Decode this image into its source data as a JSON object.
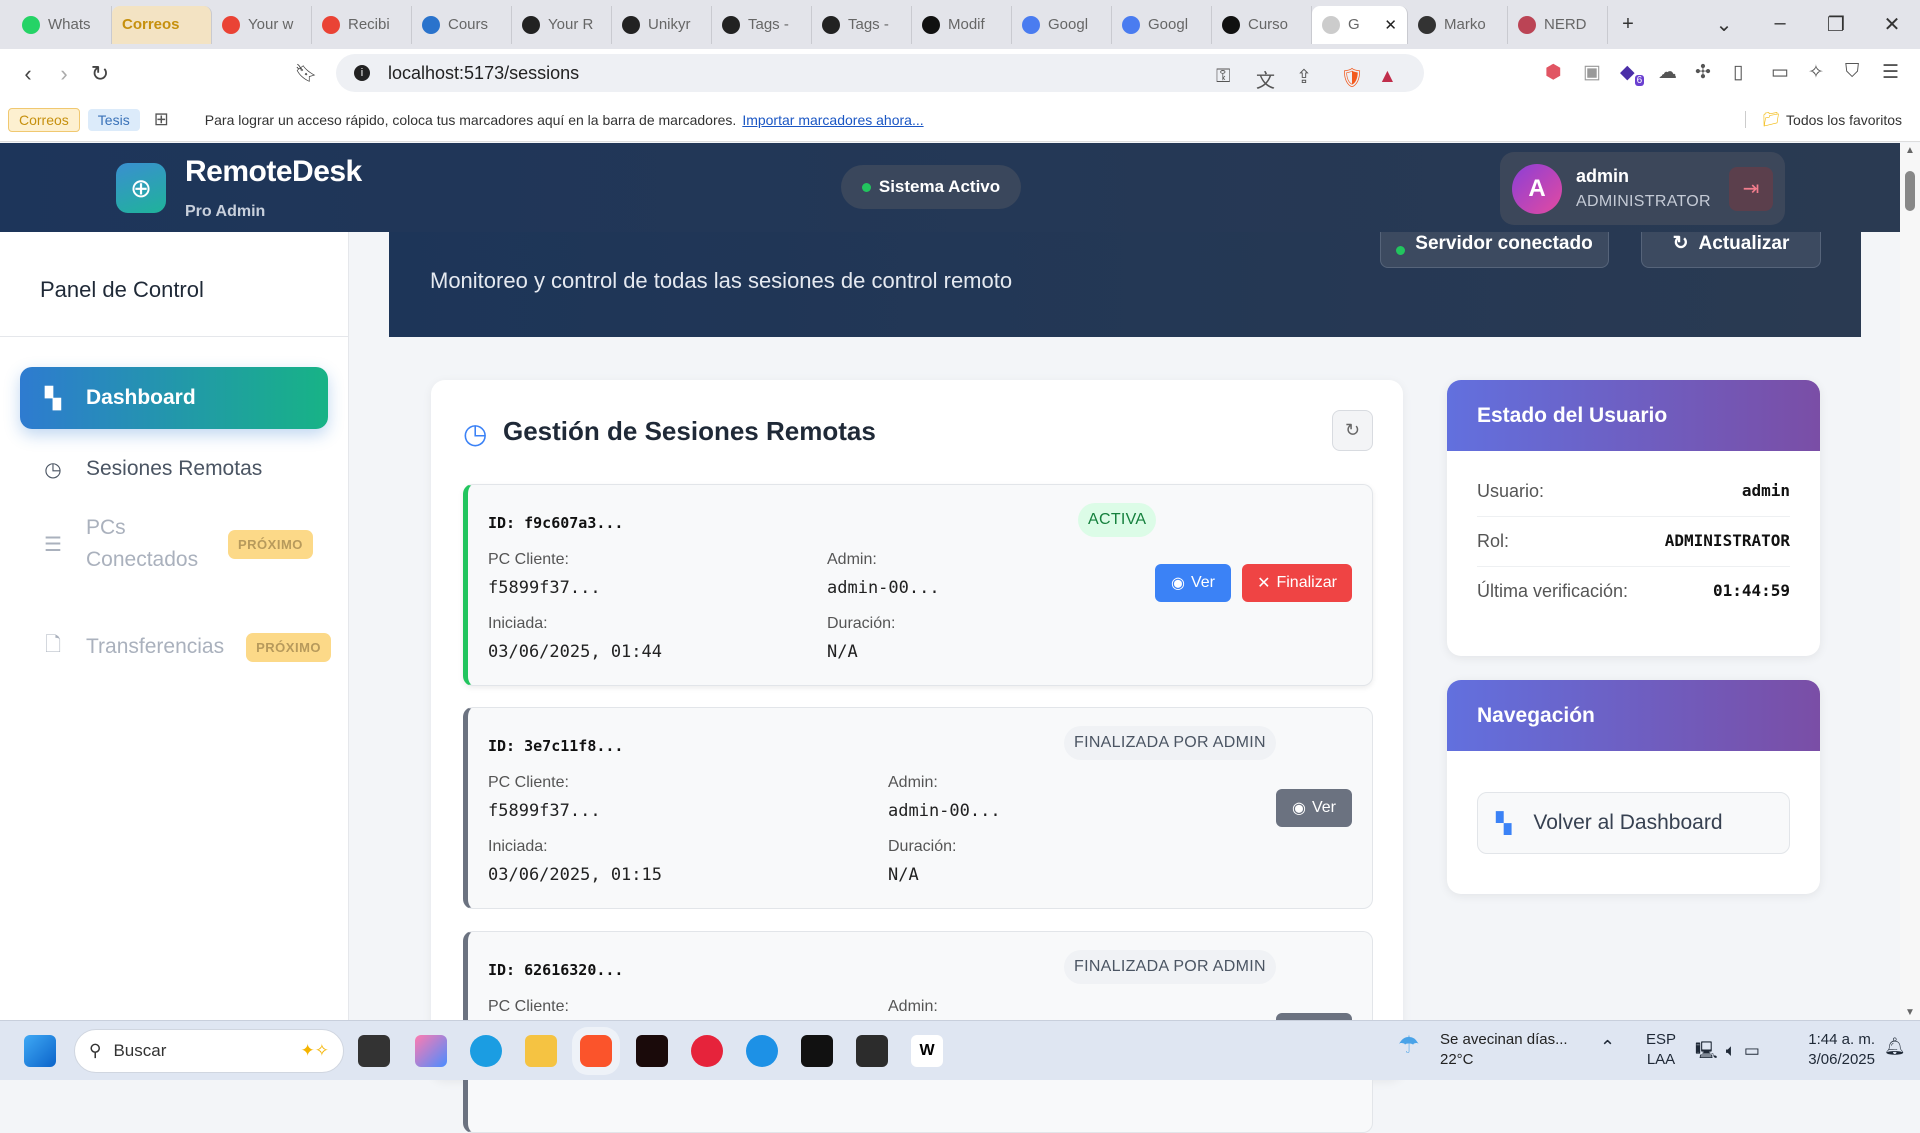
{
  "browser": {
    "tabs": [
      {
        "label": "Whats",
        "icon": "whatsapp-icon",
        "color": "#25d366"
      },
      {
        "label": "Correos",
        "icon": "",
        "color": ""
      },
      {
        "label": "Your w",
        "icon": "gmail-icon",
        "color": "#ea4335"
      },
      {
        "label": "Recibi",
        "icon": "gmail-icon",
        "color": "#ea4335"
      },
      {
        "label": "Cours",
        "icon": "coursera-icon",
        "color": "#2a73cc"
      },
      {
        "label": "Your R",
        "icon": "github-icon",
        "color": "#222"
      },
      {
        "label": "Unikyr",
        "icon": "github-icon",
        "color": "#222"
      },
      {
        "label": "Tags -",
        "icon": "github-icon",
        "color": "#222"
      },
      {
        "label": "Tags -",
        "icon": "github-icon",
        "color": "#222"
      },
      {
        "label": "Modif",
        "icon": "openai-icon",
        "color": "#111"
      },
      {
        "label": "Googl",
        "icon": "gemini-icon",
        "color": "#4a7cf0"
      },
      {
        "label": "Googl",
        "icon": "gemini-icon",
        "color": "#4a7cf0"
      },
      {
        "label": "Curso",
        "icon": "app-icon",
        "color": "#111"
      },
      {
        "label": "G",
        "icon": "loading-icon",
        "color": "#ccc"
      },
      {
        "label": "Marko",
        "icon": "markdown-icon",
        "color": "#333"
      },
      {
        "label": "NERD",
        "icon": "nerd-icon",
        "color": "#b45"
      }
    ],
    "url": "localhost:5173/sessions",
    "extension_badge": "6",
    "bookmarks": {
      "chips": [
        "Correos",
        "Tesis"
      ],
      "hint": "Para lograr un acceso rápido, coloca tus marcadores aquí en la barra de marcadores.",
      "import_link": "Importar marcadores ahora...",
      "all_favorites": "Todos los favoritos"
    }
  },
  "header": {
    "brand": "RemoteDesk",
    "brand_sub": "Pro Admin",
    "status": "Sistema Activo",
    "user": {
      "initial": "A",
      "name": "admin",
      "role": "ADMINISTRATOR"
    }
  },
  "sidebar": {
    "title": "Panel de Control",
    "items": [
      {
        "label": "Dashboard",
        "icon": "dashboard-grid-icon"
      },
      {
        "label": "Sesiones Remotas",
        "icon": "clock-icon"
      },
      {
        "label": "PCs Conectados",
        "badge": "PRÓXIMO",
        "icon": "document-list-icon"
      },
      {
        "label": "Transferencias",
        "badge": "PRÓXIMO",
        "icon": "file-icon"
      }
    ]
  },
  "banner": {
    "subtitle": "Monitoreo y control de todas las sesiones de control remoto",
    "server_status": "Servidor conectado",
    "refresh": "Actualizar"
  },
  "sessions_panel": {
    "title": "Gestión de Sesiones Remotas",
    "labels": {
      "pc": "PC Cliente:",
      "admin": "Admin:",
      "started": "Iniciada:",
      "duration": "Duración:"
    },
    "view_label": "Ver",
    "end_label": "Finalizar",
    "sessions": [
      {
        "id": "ID: f9c607a3...",
        "status": "ACTIVA",
        "pc": "f5899f37...",
        "admin": "admin-00...",
        "started": "03/06/2025, 01:44",
        "duration": "N/A"
      },
      {
        "id": "ID: 3e7c11f8...",
        "status": "FINALIZADA POR ADMIN",
        "pc": "f5899f37...",
        "admin": "admin-00...",
        "started": "03/06/2025, 01:15",
        "duration": "N/A"
      },
      {
        "id": "ID: 62616320...",
        "status": "FINALIZADA POR ADMIN",
        "pc": "",
        "admin": "",
        "started": "",
        "duration": ""
      }
    ]
  },
  "user_status": {
    "title": "Estado del Usuario",
    "rows": [
      {
        "label": "Usuario:",
        "value": "admin"
      },
      {
        "label": "Rol:",
        "value": "ADMINISTRATOR"
      },
      {
        "label": "Última verificación:",
        "value": "01:44:59"
      }
    ]
  },
  "navigation": {
    "title": "Navegación",
    "back_label": "Volver al Dashboard"
  },
  "taskbar": {
    "search_placeholder": "Buscar",
    "weather_text": "Se avecinan días...",
    "temperature": "22°C",
    "lang1": "ESP",
    "lang2": "LAA",
    "time": "1:44 a. m.",
    "date": "3/06/2025"
  }
}
